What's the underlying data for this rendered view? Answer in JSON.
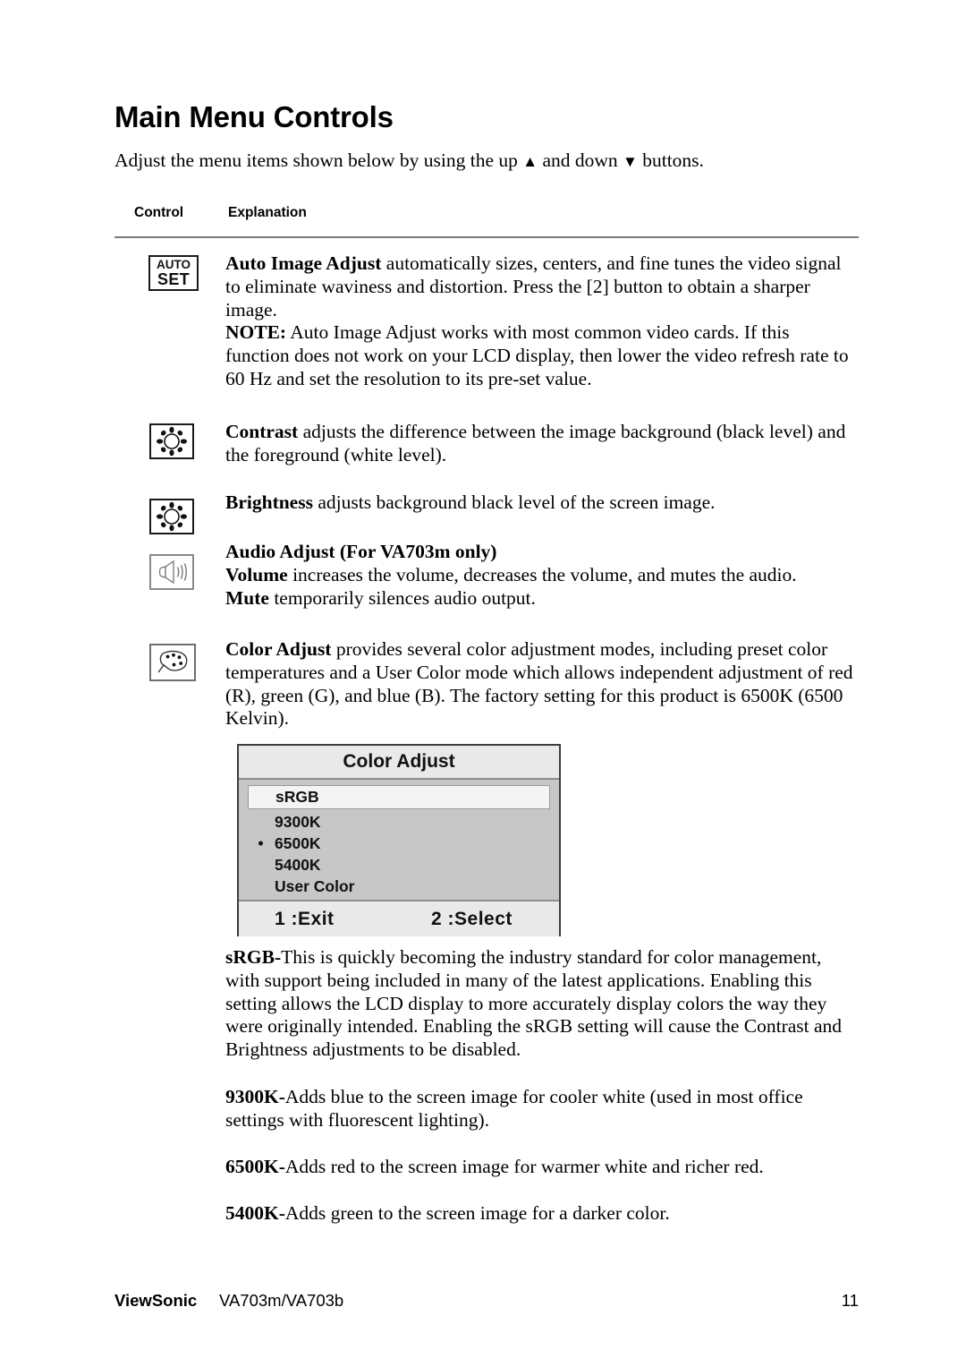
{
  "document": {
    "title": "Main Menu Controls",
    "intro_before": "Adjust the menu items shown below by using the up ",
    "intro_up_arrow": "▲",
    "intro_middle": " and down ",
    "intro_down_arrow": "▼",
    "intro_after": " buttons."
  },
  "table_headers": {
    "control": "Control",
    "explanation": "Explanation"
  },
  "rows": [
    {
      "icon": "auto-set-icon",
      "icon_line1": "AUTO",
      "icon_line2": "SET",
      "lead": "Auto Image Adjust",
      "text": " automatically sizes, centers, and fine tunes the video signal to eliminate waviness and distortion. Press the [2] button to obtain a sharper image.",
      "note_lead": "NOTE:",
      "note_text": " Auto Image Adjust works with most common video cards. If this function does not work on your LCD display, then lower the video refresh rate to 60 Hz and set the resolution to its pre-set value."
    },
    {
      "icon": "contrast-sun-icon",
      "lead": "Contrast",
      "text": " adjusts the difference between the image background  (black level) and the foreground (white level)."
    },
    {
      "icon": "brightness-sun-icon",
      "lead": "Brightness",
      "text": " adjusts background black level of the screen image."
    },
    {
      "icon": "audio-speaker-icon",
      "heading": "Audio Adjust (For VA703m only)",
      "lead": "Volume",
      "text": " increases the volume, decreases the volume, and mutes the audio.",
      "lead2": "Mute",
      "text2": " temporarily silences audio output."
    },
    {
      "icon": "color-palette-icon",
      "lead": "Color Adjust",
      "text": " provides several color adjustment modes, including preset color temperatures and a User Color mode which allows independent adjustment of red (R), green (G), and blue (B). The factory setting for this product is 6500K (6500 Kelvin)."
    }
  ],
  "osd": {
    "title": "Color Adjust",
    "items": [
      {
        "label": "sRGB",
        "selected": true,
        "marked": false
      },
      {
        "label": "9300K",
        "selected": false,
        "marked": false
      },
      {
        "label": "6500K",
        "selected": false,
        "marked": true
      },
      {
        "label": "5400K",
        "selected": false,
        "marked": false
      },
      {
        "label": "User Color",
        "selected": false,
        "marked": false
      }
    ],
    "footer_left": "1 :Exit",
    "footer_right": "2 :Select",
    "colors": {
      "body_bg": "#c7c7c7",
      "bar_bg": "#e9e9e9",
      "border": "#3d3d3d",
      "selected_bg": "#f4f4f4"
    }
  },
  "descriptions": [
    {
      "lead": "sRGB-",
      "text": "This is quickly becoming the industry standard for color management, with support being included in many of the latest applications. Enabling this setting allows the LCD display to more accurately display colors the way they were originally intended. Enabling the sRGB setting will cause the Contrast and Brightness adjustments to be disabled."
    },
    {
      "lead": "9300K-",
      "text": "Adds blue to the screen image for cooler white (used in most office settings with fluorescent lighting)."
    },
    {
      "lead": "6500K-",
      "text": "Adds red to the screen image for warmer white and richer red."
    },
    {
      "lead": "5400K-",
      "text": "Adds green to the screen image for a darker color."
    }
  ],
  "footer": {
    "brand": "ViewSonic",
    "model": "VA703m/VA703b",
    "page_number": "11"
  }
}
